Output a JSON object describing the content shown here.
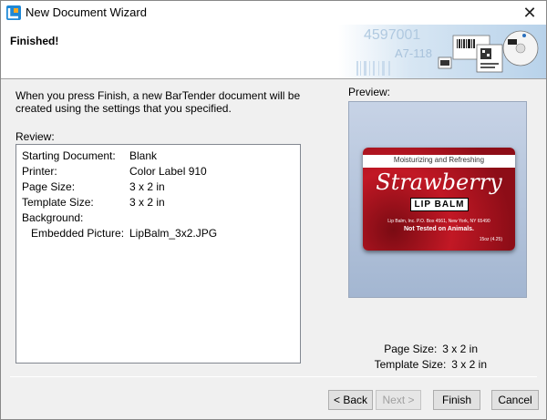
{
  "window": {
    "title": "New Document Wizard"
  },
  "header": {
    "title": "Finished!"
  },
  "banner": {
    "digits_1": "4597001",
    "digits_2": "A7-118"
  },
  "description": "When you press Finish, a new BarTender document will be created using the settings that you specified.",
  "review": {
    "label": "Review:",
    "rows": [
      {
        "key": "Starting Document:",
        "value": "Blank"
      },
      {
        "key": "Printer:",
        "value": "Color Label 910"
      },
      {
        "key": "Page Size:",
        "value": "3 x 2 in"
      },
      {
        "key": "Template Size:",
        "value": "3 x 2 in"
      },
      {
        "key": "Background:",
        "value": ""
      },
      {
        "key": "Embedded Picture:",
        "value": "LipBalm_3x2.JPG"
      }
    ]
  },
  "preview": {
    "label": "Preview:",
    "label_art": {
      "subtitle": "Moisturizing and Refreshing",
      "title": "Strawberry",
      "product": "LIP BALM",
      "address": "Lip Balm, Inc. P.O. Box 4561, New York, NY 65490",
      "note": "Not Tested on Animals.",
      "weight": "15oz (4.25)"
    },
    "page_size_label": "Page Size:",
    "page_size_value": "3 x 2 in",
    "template_size_label": "Template Size:",
    "template_size_value": "3 x 2 in"
  },
  "buttons": {
    "back": "< Back",
    "next": "Next >",
    "finish": "Finish",
    "cancel": "Cancel"
  },
  "colors": {
    "label_red": "#c21825",
    "banner_blue": "#cfe0f0"
  }
}
